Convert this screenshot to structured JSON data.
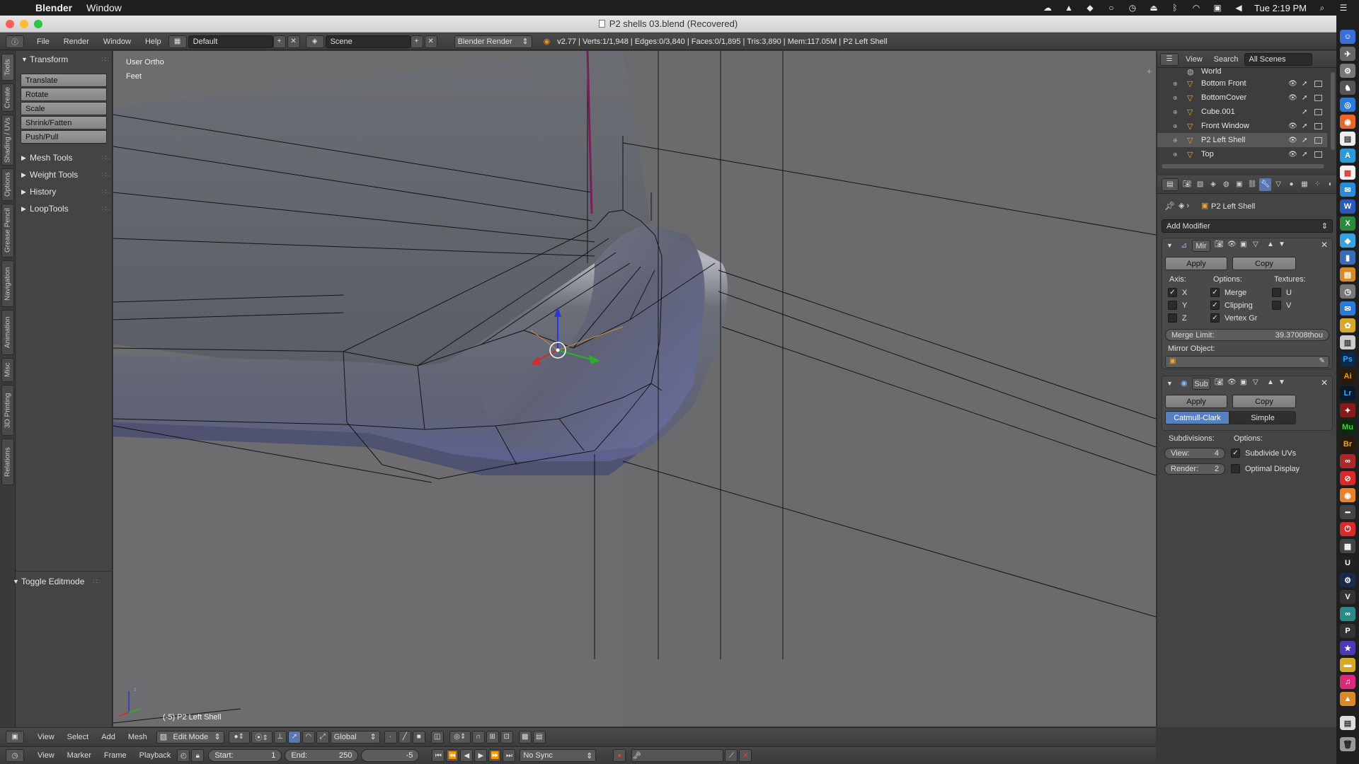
{
  "menubar": {
    "app_name": "Blender",
    "items": [
      "Window"
    ],
    "clock": "Tue 2:19 PM"
  },
  "window": {
    "title": "P2 shells 03.blend (Recovered)"
  },
  "info_header": {
    "menus": [
      "File",
      "Render",
      "Window",
      "Help"
    ],
    "layout": "Default",
    "scene": "Scene",
    "engine": "Blender Render",
    "stats": "v2.77 | Verts:1/1,948 | Edges:0/3,840 | Faces:0/1,895 | Tris:3,890 | Mem:117.05M | P2 Left Shell"
  },
  "vertical_tabs": [
    "Tools",
    "Create",
    "Shading / UVs",
    "Options",
    "Grease Pencil",
    "Navigation",
    "Animation",
    "Misc",
    "3D Printing",
    "Relations"
  ],
  "toolshelf": {
    "transform_title": "Transform",
    "transform_buttons": [
      "Translate",
      "Rotate",
      "Scale",
      "Shrink/Fatten",
      "Push/Pull"
    ],
    "collapsed_panels": [
      "Mesh Tools",
      "Weight Tools",
      "History",
      "LoopTools"
    ],
    "operator_panel": "Toggle Editmode"
  },
  "viewport": {
    "view_name": "User Ortho",
    "units": "Feet",
    "object_label": "(-5) P2 Left Shell",
    "axis_z": "z"
  },
  "view3d_header": {
    "menus": [
      "View",
      "Select",
      "Add",
      "Mesh"
    ],
    "mode": "Edit Mode",
    "orientation": "Global"
  },
  "timeline_header": {
    "menus": [
      "View",
      "Marker",
      "Frame",
      "Playback"
    ],
    "start_label": "Start:",
    "start_value": "1",
    "end_label": "End:",
    "end_value": "250",
    "current_frame": "-5",
    "sync": "No Sync"
  },
  "outliner": {
    "menus": [
      "View",
      "Search"
    ],
    "scope": "All Scenes",
    "rows": [
      {
        "name": "World"
      },
      {
        "name": "Bottom Front"
      },
      {
        "name": "BottomCover"
      },
      {
        "name": "Cube.001"
      },
      {
        "name": "Front Window"
      },
      {
        "name": "P2 Left Shell"
      },
      {
        "name": "Top"
      }
    ]
  },
  "properties": {
    "object_name": "P2 Left Shell",
    "add_modifier": "Add Modifier",
    "mirror": {
      "name": "Mir",
      "apply": "Apply",
      "copy": "Copy",
      "axis_label": "Axis:",
      "options_label": "Options:",
      "textures_label": "Textures:",
      "axes": [
        "X",
        "Y",
        "Z"
      ],
      "options": [
        "Merge",
        "Clipping",
        "Vertex Gr"
      ],
      "textures": [
        "U",
        "V"
      ],
      "merge_limit_label": "Merge Limit:",
      "merge_limit_value": "39.37008thou",
      "mirror_object_label": "Mirror Object:"
    },
    "subsurf": {
      "name": "Sub",
      "apply": "Apply",
      "copy": "Copy",
      "type_catmull": "Catmull-Clark",
      "type_simple": "Simple",
      "subdivisions_label": "Subdivisions:",
      "options_label": "Options:",
      "view_label": "View:",
      "view_value": "4",
      "render_label": "Render:",
      "render_value": "2",
      "subdivide_uvs": "Subdivide UVs",
      "optimal_display": "Optimal Display"
    }
  },
  "colors": {
    "viewport_bg": "#6d6d6f",
    "accent_blue": "#5a78b0",
    "mesh_face": "#5d6177",
    "wire": "#111111"
  },
  "dock_icons": [
    "Ps",
    "Ai",
    "Lr",
    "Mu",
    "Br",
    "U",
    "P"
  ]
}
